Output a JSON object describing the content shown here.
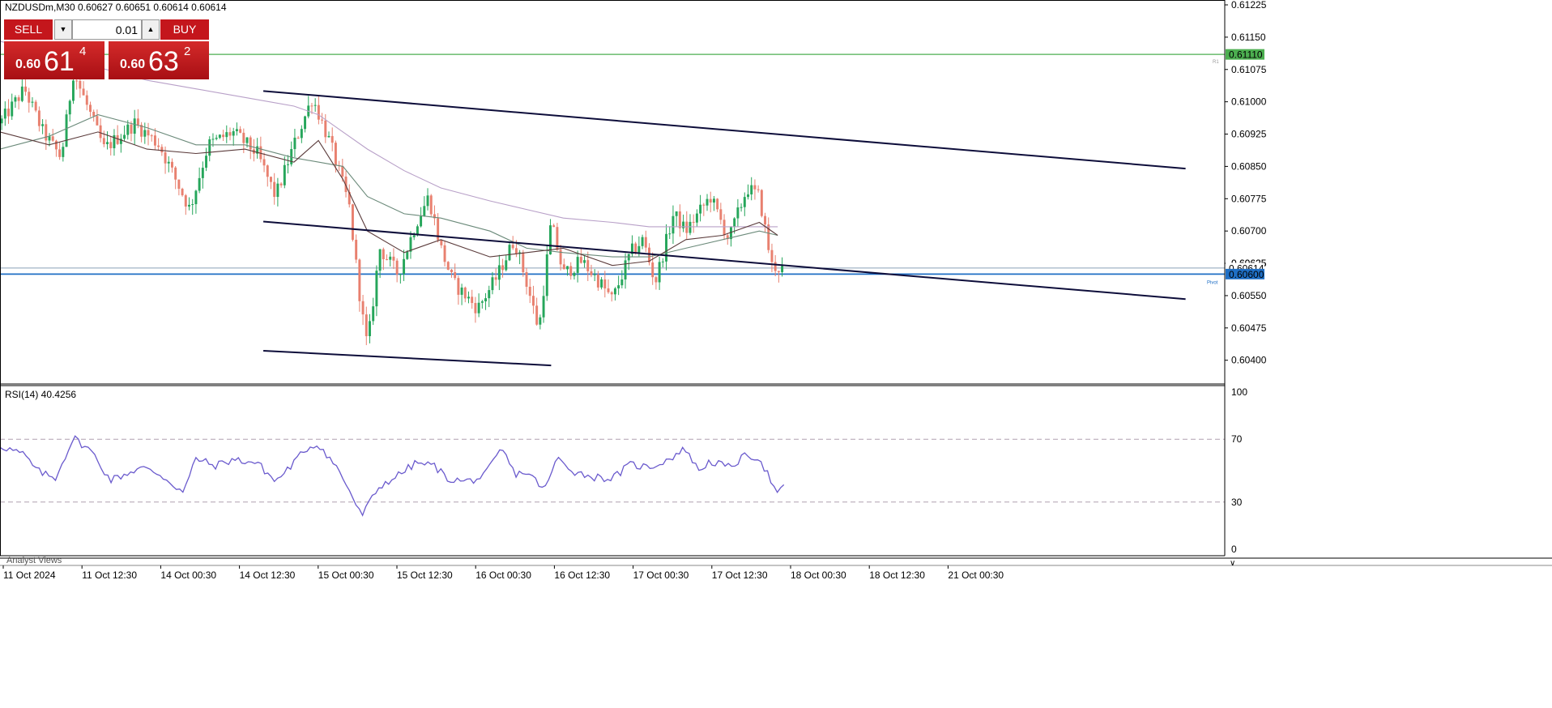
{
  "header": {
    "symbol_text": "NZDUSDm,M30  0.60627 0.60651 0.60614 0.60614"
  },
  "trade_panel": {
    "sell_label": "SELL",
    "buy_label": "BUY",
    "lot_value": "0.01",
    "sell_prefix": "0.60",
    "sell_big": "61",
    "sell_sup": "4",
    "buy_prefix": "0.60",
    "buy_big": "63",
    "buy_sup": "2"
  },
  "rsi_header": "RSI(14) 40.4256",
  "analyst_tab": "Analyst Views",
  "colors": {
    "bull": "#26a65b",
    "bear": "#e8806f",
    "ma_fast": "#5a3a3a",
    "ma_mid": "#6b8a7a",
    "ma_slow": "#b8a0c8",
    "channel": "#0d0d3a",
    "pivot": "#1f6fc5",
    "r1": "#4caf50",
    "rsi_line": "#6a5acd"
  },
  "chart_data": [
    {
      "type": "candlestick",
      "ylim": [
        0.60375,
        0.61225
      ],
      "y_ticks": [
        "0.61225",
        "0.61150",
        "0.61075",
        "0.61000",
        "0.60925",
        "0.60850",
        "0.60775",
        "0.60700",
        "0.60625",
        "0.60550",
        "0.60475",
        "0.60400"
      ],
      "x_ticks": [
        "11 Oct 2024",
        "11 Oct 12:30",
        "14 Oct 00:30",
        "14 Oct 12:30",
        "15 Oct 00:30",
        "15 Oct 12:30",
        "16 Oct 00:30",
        "16 Oct 12:30",
        "17 Oct 00:30",
        "17 Oct 12:30",
        "18 Oct 00:30",
        "18 Oct 12:30",
        "21 Oct 00:30"
      ],
      "levels": [
        {
          "name": "R1",
          "value": 0.6111,
          "label": "0.61110"
        },
        {
          "name": "Pivot",
          "value": 0.606,
          "label": "0.60600"
        },
        {
          "name": "current",
          "value": 0.60614,
          "label": "0.60614"
        }
      ],
      "level_marks": {
        "r1": "R1",
        "pivot": "Pivot",
        "current_tick": "0.60625"
      },
      "channel_lines": [
        {
          "x": [
            0.215,
            0.968
          ],
          "y": [
            0.61025,
            0.60845
          ]
        },
        {
          "x": [
            0.215,
            0.968
          ],
          "y": [
            0.60722,
            0.60542
          ]
        },
        {
          "x": [
            0.215,
            0.45
          ],
          "y": [
            0.60422,
            0.60388
          ]
        }
      ],
      "ma_path_fast": [
        [
          0,
          0.6093
        ],
        [
          0.04,
          0.609
        ],
        [
          0.08,
          0.6093
        ],
        [
          0.12,
          0.6089
        ],
        [
          0.16,
          0.6088
        ],
        [
          0.2,
          0.6089
        ],
        [
          0.24,
          0.6086
        ],
        [
          0.26,
          0.6091
        ],
        [
          0.28,
          0.6082
        ],
        [
          0.3,
          0.607
        ],
        [
          0.33,
          0.6065
        ],
        [
          0.36,
          0.6068
        ],
        [
          0.4,
          0.6064
        ],
        [
          0.43,
          0.6065
        ],
        [
          0.46,
          0.6066
        ],
        [
          0.5,
          0.6062
        ],
        [
          0.53,
          0.6063
        ],
        [
          0.56,
          0.6068
        ],
        [
          0.59,
          0.6069
        ],
        [
          0.62,
          0.6072
        ],
        [
          0.635,
          0.6069
        ]
      ],
      "ma_path_mid": [
        [
          0,
          0.6089
        ],
        [
          0.04,
          0.6092
        ],
        [
          0.08,
          0.6097
        ],
        [
          0.12,
          0.6094
        ],
        [
          0.16,
          0.609
        ],
        [
          0.2,
          0.609
        ],
        [
          0.24,
          0.6087
        ],
        [
          0.28,
          0.6085
        ],
        [
          0.3,
          0.6078
        ],
        [
          0.33,
          0.6074
        ],
        [
          0.36,
          0.6073
        ],
        [
          0.4,
          0.607
        ],
        [
          0.43,
          0.6066
        ],
        [
          0.46,
          0.6065
        ],
        [
          0.5,
          0.6064
        ],
        [
          0.53,
          0.6064
        ],
        [
          0.56,
          0.6066
        ],
        [
          0.59,
          0.6068
        ],
        [
          0.62,
          0.607
        ],
        [
          0.635,
          0.6069
        ]
      ],
      "ma_path_slow": [
        [
          0,
          0.6114
        ],
        [
          0.04,
          0.6112
        ],
        [
          0.08,
          0.6108
        ],
        [
          0.12,
          0.6105
        ],
        [
          0.16,
          0.6103
        ],
        [
          0.2,
          0.6101
        ],
        [
          0.24,
          0.6099
        ],
        [
          0.26,
          0.6097
        ],
        [
          0.28,
          0.6093
        ],
        [
          0.3,
          0.6089
        ],
        [
          0.33,
          0.6084
        ],
        [
          0.36,
          0.608
        ],
        [
          0.4,
          0.6077
        ],
        [
          0.43,
          0.6075
        ],
        [
          0.46,
          0.6073
        ],
        [
          0.5,
          0.6072
        ],
        [
          0.53,
          0.6071
        ],
        [
          0.56,
          0.6071
        ],
        [
          0.59,
          0.6071
        ],
        [
          0.62,
          0.6071
        ],
        [
          0.635,
          0.6071
        ]
      ],
      "price_waypoints": [
        [
          0,
          0.6095
        ],
        [
          0.02,
          0.6103
        ],
        [
          0.035,
          0.6093
        ],
        [
          0.05,
          0.6087
        ],
        [
          0.06,
          0.6107
        ],
        [
          0.085,
          0.6089
        ],
        [
          0.11,
          0.6095
        ],
        [
          0.13,
          0.609
        ],
        [
          0.155,
          0.6075
        ],
        [
          0.17,
          0.609
        ],
        [
          0.19,
          0.6093
        ],
        [
          0.21,
          0.6088
        ],
        [
          0.225,
          0.6078
        ],
        [
          0.24,
          0.609
        ],
        [
          0.255,
          0.6101
        ],
        [
          0.27,
          0.609
        ],
        [
          0.285,
          0.6076
        ],
        [
          0.295,
          0.6052
        ],
        [
          0.3,
          0.6043
        ],
        [
          0.31,
          0.6066
        ],
        [
          0.325,
          0.606
        ],
        [
          0.34,
          0.6072
        ],
        [
          0.35,
          0.6078
        ],
        [
          0.36,
          0.6066
        ],
        [
          0.37,
          0.6058
        ],
        [
          0.39,
          0.6052
        ],
        [
          0.405,
          0.6059
        ],
        [
          0.42,
          0.6068
        ],
        [
          0.43,
          0.6058
        ],
        [
          0.44,
          0.6047
        ],
        [
          0.45,
          0.6072
        ],
        [
          0.46,
          0.606
        ],
        [
          0.475,
          0.6063
        ],
        [
          0.49,
          0.6058
        ],
        [
          0.5,
          0.6054
        ],
        [
          0.515,
          0.6065
        ],
        [
          0.525,
          0.6068
        ],
        [
          0.535,
          0.6058
        ],
        [
          0.55,
          0.6074
        ],
        [
          0.56,
          0.607
        ],
        [
          0.58,
          0.6078
        ],
        [
          0.595,
          0.6068
        ],
        [
          0.61,
          0.608
        ],
        [
          0.62,
          0.6078
        ],
        [
          0.63,
          0.6062
        ],
        [
          0.64,
          0.6061
        ]
      ],
      "rsi": {
        "ylim": [
          0,
          100
        ],
        "ticks": [
          "100",
          "70",
          "30",
          "0"
        ],
        "levels": [
          70,
          30
        ],
        "x_end": 0.64,
        "waypoints": [
          [
            0,
            66
          ],
          [
            0.02,
            60
          ],
          [
            0.03,
            50
          ],
          [
            0.045,
            45
          ],
          [
            0.06,
            71
          ],
          [
            0.075,
            62
          ],
          [
            0.09,
            44
          ],
          [
            0.1,
            47
          ],
          [
            0.115,
            52
          ],
          [
            0.13,
            48
          ],
          [
            0.15,
            36
          ],
          [
            0.16,
            58
          ],
          [
            0.175,
            53
          ],
          [
            0.19,
            57
          ],
          [
            0.21,
            55
          ],
          [
            0.225,
            43
          ],
          [
            0.24,
            55
          ],
          [
            0.25,
            64
          ],
          [
            0.26,
            67
          ],
          [
            0.275,
            52
          ],
          [
            0.285,
            38
          ],
          [
            0.295,
            21
          ],
          [
            0.31,
            40
          ],
          [
            0.325,
            47
          ],
          [
            0.34,
            55
          ],
          [
            0.355,
            53
          ],
          [
            0.365,
            45
          ],
          [
            0.38,
            43
          ],
          [
            0.395,
            46
          ],
          [
            0.41,
            64
          ],
          [
            0.42,
            48
          ],
          [
            0.43,
            49
          ],
          [
            0.445,
            38
          ],
          [
            0.455,
            58
          ],
          [
            0.47,
            49
          ],
          [
            0.485,
            46
          ],
          [
            0.5,
            45
          ],
          [
            0.515,
            54
          ],
          [
            0.53,
            52
          ],
          [
            0.545,
            57
          ],
          [
            0.56,
            64
          ],
          [
            0.57,
            50
          ],
          [
            0.58,
            56
          ],
          [
            0.595,
            52
          ],
          [
            0.61,
            60
          ],
          [
            0.62,
            58
          ],
          [
            0.628,
            46
          ],
          [
            0.635,
            34
          ],
          [
            0.64,
            40
          ]
        ]
      }
    }
  ]
}
